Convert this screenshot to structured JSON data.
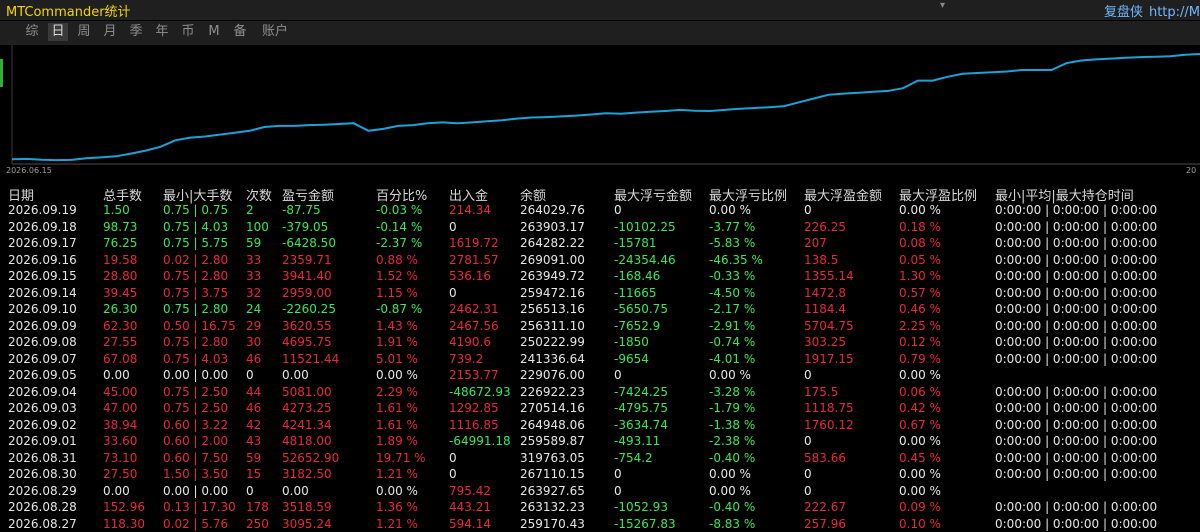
{
  "window": {
    "title": "MTCommander统计",
    "right_brand": "复盘侠",
    "right_url": "http://M"
  },
  "tabs": [
    "综",
    "日",
    "周",
    "月",
    "季",
    "年",
    "币",
    "M",
    "备",
    "账户"
  ],
  "active_tab": 1,
  "chart_data": {
    "type": "line",
    "x_start_label": "2026.06.15",
    "x_end_label": "20",
    "color": "#1aa3d8",
    "values": [
      1.5,
      1.6,
      1.4,
      1.3,
      1.35,
      1.8,
      2.0,
      2.3,
      3.0,
      3.8,
      4.8,
      6.5,
      7.2,
      7.5,
      8.0,
      8.5,
      9.0,
      10.0,
      10.3,
      10.3,
      10.5,
      10.6,
      10.8,
      11.0,
      9.0,
      9.5,
      10.3,
      10.5,
      11.0,
      11.2,
      11.0,
      11.2,
      11.5,
      11.8,
      12.2,
      12.5,
      12.6,
      12.8,
      13.0,
      13.3,
      13.6,
      13.5,
      13.8,
      14.0,
      14.2,
      14.5,
      14.3,
      14.2,
      14.5,
      14.8,
      15.0,
      15.2,
      15.5,
      16.5,
      17.5,
      18.5,
      18.8,
      19.0,
      19.3,
      19.5,
      20.2,
      22.2,
      22.2,
      23.2,
      24.0,
      24.2,
      24.4,
      24.6,
      25.0,
      25.0,
      25.0,
      26.8,
      27.5,
      27.8,
      28.0,
      28.2,
      28.4,
      28.5,
      28.6,
      29.0,
      29.2
    ]
  },
  "table": {
    "headers": [
      "日期",
      "总手数",
      "最小|大手数",
      "次数",
      "盈亏金额",
      "百分比%",
      "出入金",
      "余额",
      "最大浮亏金额",
      "最大浮亏比例",
      "最大浮盈金额",
      "最大浮盈比例",
      "最小|平均|最大持仓时间"
    ],
    "rows": [
      {
        "date": "2026.09.19",
        "lots": "1.50",
        "minmax": "0.75 | 0.75",
        "count": "2",
        "pnl": "-87.75",
        "pct": "-0.03 %",
        "flow": "214.34",
        "bal": "264029.76",
        "mfl": "0",
        "mflp": "0.00 %",
        "mfp": "0",
        "mfpp": "0.00 %",
        "hold": "0:00:00 | 0:00:00 | 0:00:00",
        "tone": "g",
        "flow_tone": "r",
        "mfl_tone": "w",
        "mfp_tone": "w"
      },
      {
        "date": "2026.09.18",
        "lots": "98.73",
        "minmax": "0.75 | 4.03",
        "count": "100",
        "pnl": "-379.05",
        "pct": "-0.14 %",
        "flow": "0",
        "bal": "263903.17",
        "mfl": "-10102.25",
        "mflp": "-3.77 %",
        "mfp": "226.25",
        "mfpp": "0.18 %",
        "hold": "0:00:00 | 0:00:00 | 0:00:00",
        "tone": "g",
        "flow_tone": "w",
        "mfl_tone": "g",
        "mfp_tone": "r"
      },
      {
        "date": "2026.09.17",
        "lots": "76.25",
        "minmax": "0.75 | 5.75",
        "count": "59",
        "pnl": "-6428.50",
        "pct": "-2.37 %",
        "flow": "1619.72",
        "bal": "264282.22",
        "mfl": "-15781",
        "mflp": "-5.83 %",
        "mfp": "207",
        "mfpp": "0.08 %",
        "hold": "0:00:00 | 0:00:00 | 0:00:00",
        "tone": "g",
        "flow_tone": "r",
        "mfl_tone": "g",
        "mfp_tone": "r"
      },
      {
        "date": "2026.09.16",
        "lots": "19.58",
        "minmax": "0.02 | 2.80",
        "count": "33",
        "pnl": "2359.71",
        "pct": "0.88 %",
        "flow": "2781.57",
        "bal": "269091.00",
        "mfl": "-24354.46",
        "mflp": "-46.35 %",
        "mfp": "138.5",
        "mfpp": "0.05 %",
        "hold": "0:00:00 | 0:00:00 | 0:00:00",
        "tone": "r",
        "flow_tone": "r",
        "mfl_tone": "g",
        "mfp_tone": "r"
      },
      {
        "date": "2026.09.15",
        "lots": "28.80",
        "minmax": "0.75 | 2.80",
        "count": "33",
        "pnl": "3941.40",
        "pct": "1.52 %",
        "flow": "536.16",
        "bal": "263949.72",
        "mfl": "-168.46",
        "mflp": "-0.33 %",
        "mfp": "1355.14",
        "mfpp": "1.30 %",
        "hold": "0:00:00 | 0:00:00 | 0:00:00",
        "tone": "r",
        "flow_tone": "r",
        "mfl_tone": "g",
        "mfp_tone": "r"
      },
      {
        "date": "2026.09.14",
        "lots": "39.45",
        "minmax": "0.75 | 3.75",
        "count": "32",
        "pnl": "2959.00",
        "pct": "1.15 %",
        "flow": "0",
        "bal": "259472.16",
        "mfl": "-11665",
        "mflp": "-4.50 %",
        "mfp": "1472.8",
        "mfpp": "0.57 %",
        "hold": "0:00:00 | 0:00:00 | 0:00:00",
        "tone": "r",
        "flow_tone": "w",
        "mfl_tone": "g",
        "mfp_tone": "r"
      },
      {
        "date": "2026.09.10",
        "lots": "26.30",
        "minmax": "0.75 | 2.80",
        "count": "24",
        "pnl": "-2260.25",
        "pct": "-0.87 %",
        "flow": "2462.31",
        "bal": "256513.16",
        "mfl": "-5650.75",
        "mflp": "-2.17 %",
        "mfp": "1184.4",
        "mfpp": "0.46 %",
        "hold": "0:00:00 | 0:00:00 | 0:00:00",
        "tone": "g",
        "flow_tone": "r",
        "mfl_tone": "g",
        "mfp_tone": "r"
      },
      {
        "date": "2026.09.09",
        "lots": "62.30",
        "minmax": "0.50 | 16.75",
        "count": "29",
        "pnl": "3620.55",
        "pct": "1.43 %",
        "flow": "2467.56",
        "bal": "256311.10",
        "mfl": "-7652.9",
        "mflp": "-2.91 %",
        "mfp": "5704.75",
        "mfpp": "2.25 %",
        "hold": "0:00:00 | 0:00:00 | 0:00:00",
        "tone": "r",
        "flow_tone": "r",
        "mfl_tone": "g",
        "mfp_tone": "r"
      },
      {
        "date": "2026.09.08",
        "lots": "27.55",
        "minmax": "0.75 | 2.80",
        "count": "30",
        "pnl": "4695.75",
        "pct": "1.91 %",
        "flow": "4190.6",
        "bal": "250222.99",
        "mfl": "-1850",
        "mflp": "-0.74 %",
        "mfp": "303.25",
        "mfpp": "0.12 %",
        "hold": "0:00:00 | 0:00:00 | 0:00:00",
        "tone": "r",
        "flow_tone": "r",
        "mfl_tone": "g",
        "mfp_tone": "r"
      },
      {
        "date": "2026.09.07",
        "lots": "67.08",
        "minmax": "0.75 | 4.03",
        "count": "46",
        "pnl": "11521.44",
        "pct": "5.01 %",
        "flow": "739.2",
        "bal": "241336.64",
        "mfl": "-9654",
        "mflp": "-4.01 %",
        "mfp": "1917.15",
        "mfpp": "0.79 %",
        "hold": "0:00:00 | 0:00:00 | 0:00:00",
        "tone": "r",
        "flow_tone": "r",
        "mfl_tone": "g",
        "mfp_tone": "r"
      },
      {
        "date": "2026.09.05",
        "lots": "0.00",
        "minmax": "0.00 | 0.00",
        "count": "0",
        "pnl": "0.00",
        "pct": "0.00 %",
        "flow": "2153.77",
        "bal": "229076.00",
        "mfl": "0",
        "mflp": "0.00 %",
        "mfp": "0",
        "mfpp": "0.00 %",
        "hold": "",
        "tone": "w",
        "flow_tone": "r",
        "mfl_tone": "w",
        "mfp_tone": "w"
      },
      {
        "date": "2026.09.04",
        "lots": "45.00",
        "minmax": "0.75 | 2.50",
        "count": "44",
        "pnl": "5081.00",
        "pct": "2.29 %",
        "flow": "-48672.93",
        "bal": "226922.23",
        "mfl": "-7424.25",
        "mflp": "-3.28 %",
        "mfp": "175.5",
        "mfpp": "0.06 %",
        "hold": "0:00:00 | 0:00:00 | 0:00:00",
        "tone": "r",
        "flow_tone": "g",
        "mfl_tone": "g",
        "mfp_tone": "r"
      },
      {
        "date": "2026.09.03",
        "lots": "47.00",
        "minmax": "0.75 | 2.50",
        "count": "46",
        "pnl": "4273.25",
        "pct": "1.61 %",
        "flow": "1292.85",
        "bal": "270514.16",
        "mfl": "-4795.75",
        "mflp": "-1.79 %",
        "mfp": "1118.75",
        "mfpp": "0.42 %",
        "hold": "0:00:00 | 0:00:00 | 0:00:00",
        "tone": "r",
        "flow_tone": "r",
        "mfl_tone": "g",
        "mfp_tone": "r"
      },
      {
        "date": "2026.09.02",
        "lots": "38.94",
        "minmax": "0.60 | 3.22",
        "count": "42",
        "pnl": "4241.34",
        "pct": "1.61 %",
        "flow": "1116.85",
        "bal": "264948.06",
        "mfl": "-3634.74",
        "mflp": "-1.38 %",
        "mfp": "1760.12",
        "mfpp": "0.67 %",
        "hold": "0:00:00 | 0:00:00 | 0:00:00",
        "tone": "r",
        "flow_tone": "r",
        "mfl_tone": "g",
        "mfp_tone": "r"
      },
      {
        "date": "2026.09.01",
        "lots": "33.60",
        "minmax": "0.60 | 2.00",
        "count": "43",
        "pnl": "4818.00",
        "pct": "1.89 %",
        "flow": "-64991.18",
        "bal": "259589.87",
        "mfl": "-493.11",
        "mflp": "-2.38 %",
        "mfp": "0",
        "mfpp": "0.00 %",
        "hold": "0:00:00 | 0:00:00 | 0:00:00",
        "tone": "r",
        "flow_tone": "g",
        "mfl_tone": "g",
        "mfp_tone": "w"
      },
      {
        "date": "2026.08.31",
        "lots": "73.10",
        "minmax": "0.60 | 7.50",
        "count": "59",
        "pnl": "52652.90",
        "pct": "19.71 %",
        "flow": "0",
        "bal": "319763.05",
        "mfl": "-754.2",
        "mflp": "-0.40 %",
        "mfp": "583.66",
        "mfpp": "0.45 %",
        "hold": "0:00:00 | 0:00:00 | 0:00:00",
        "tone": "r",
        "flow_tone": "w",
        "mfl_tone": "g",
        "mfp_tone": "r"
      },
      {
        "date": "2026.08.30",
        "lots": "27.50",
        "minmax": "1.50 | 3.50",
        "count": "15",
        "pnl": "3182.50",
        "pct": "1.21 %",
        "flow": "0",
        "bal": "267110.15",
        "mfl": "0",
        "mflp": "0.00 %",
        "mfp": "0",
        "mfpp": "0.00 %",
        "hold": "0:00:00 | 0:00:00 | 0:00:00",
        "tone": "r",
        "flow_tone": "w",
        "mfl_tone": "w",
        "mfp_tone": "w"
      },
      {
        "date": "2026.08.29",
        "lots": "0.00",
        "minmax": "0.00 | 0.00",
        "count": "0",
        "pnl": "0.00",
        "pct": "0.00 %",
        "flow": "795.42",
        "bal": "263927.65",
        "mfl": "0",
        "mflp": "0.00 %",
        "mfp": "0",
        "mfpp": "0.00 %",
        "hold": "",
        "tone": "w",
        "flow_tone": "r",
        "mfl_tone": "w",
        "mfp_tone": "w"
      },
      {
        "date": "2026.08.28",
        "lots": "152.96",
        "minmax": "0.13 | 17.30",
        "count": "178",
        "pnl": "3518.59",
        "pct": "1.36 %",
        "flow": "443.21",
        "bal": "263132.23",
        "mfl": "-1052.93",
        "mflp": "-0.40 %",
        "mfp": "222.67",
        "mfpp": "0.09 %",
        "hold": "0:00:00 | 0:00:00 | 0:00:00",
        "tone": "r",
        "flow_tone": "r",
        "mfl_tone": "g",
        "mfp_tone": "r"
      },
      {
        "date": "2026.08.27",
        "lots": "118.30",
        "minmax": "0.02 | 5.76",
        "count": "250",
        "pnl": "3095.24",
        "pct": "1.21 %",
        "flow": "594.14",
        "bal": "259170.43",
        "mfl": "-15267.83",
        "mflp": "-8.83 %",
        "mfp": "257.96",
        "mfpp": "0.10 %",
        "hold": "0:00:00 | 0:00:00 | 0:00:00",
        "tone": "r",
        "flow_tone": "r",
        "mfl_tone": "g",
        "mfp_tone": "r"
      }
    ]
  }
}
